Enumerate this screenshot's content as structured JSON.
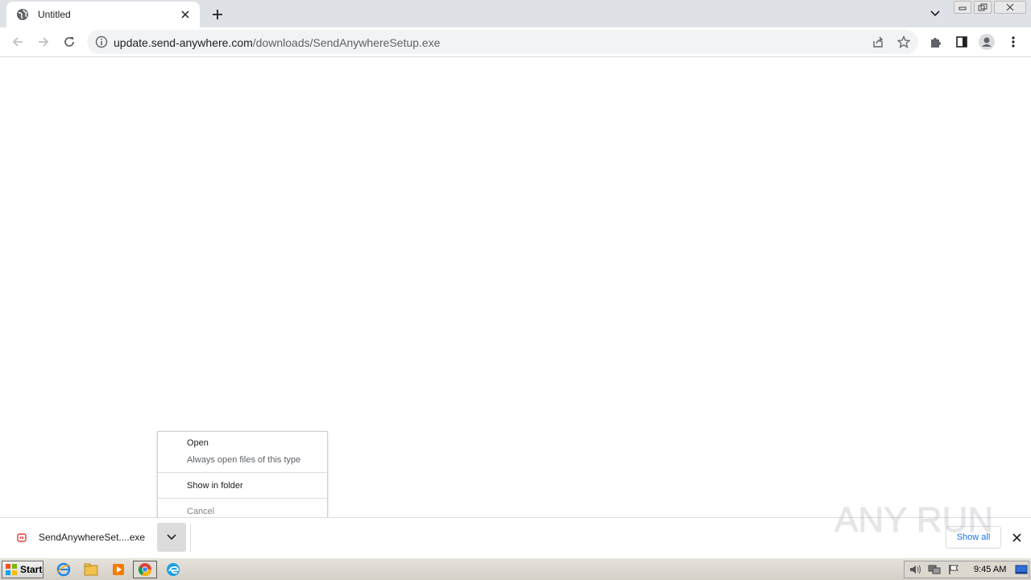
{
  "browser": {
    "tab": {
      "title": "Untitled"
    },
    "omnibox": {
      "host": "update.send-anywhere.com",
      "path": "/downloads/SendAnywhereSetup.exe"
    }
  },
  "context_menu": {
    "open": "Open",
    "always_open": "Always open files of this type",
    "show_in_folder": "Show in folder",
    "cancel": "Cancel"
  },
  "download_shelf": {
    "file_name": "SendAnywhereSet....exe",
    "show_all": "Show all"
  },
  "watermark": {
    "text": "ANY RUN"
  },
  "taskbar": {
    "start_label": "Start",
    "clock": "9:45 AM"
  },
  "colors": {
    "tabstrip": "#dee1e6",
    "omnibox": "#f1f3f4",
    "link_blue": "#1a73e8",
    "download_icon_red": "#e53935"
  }
}
